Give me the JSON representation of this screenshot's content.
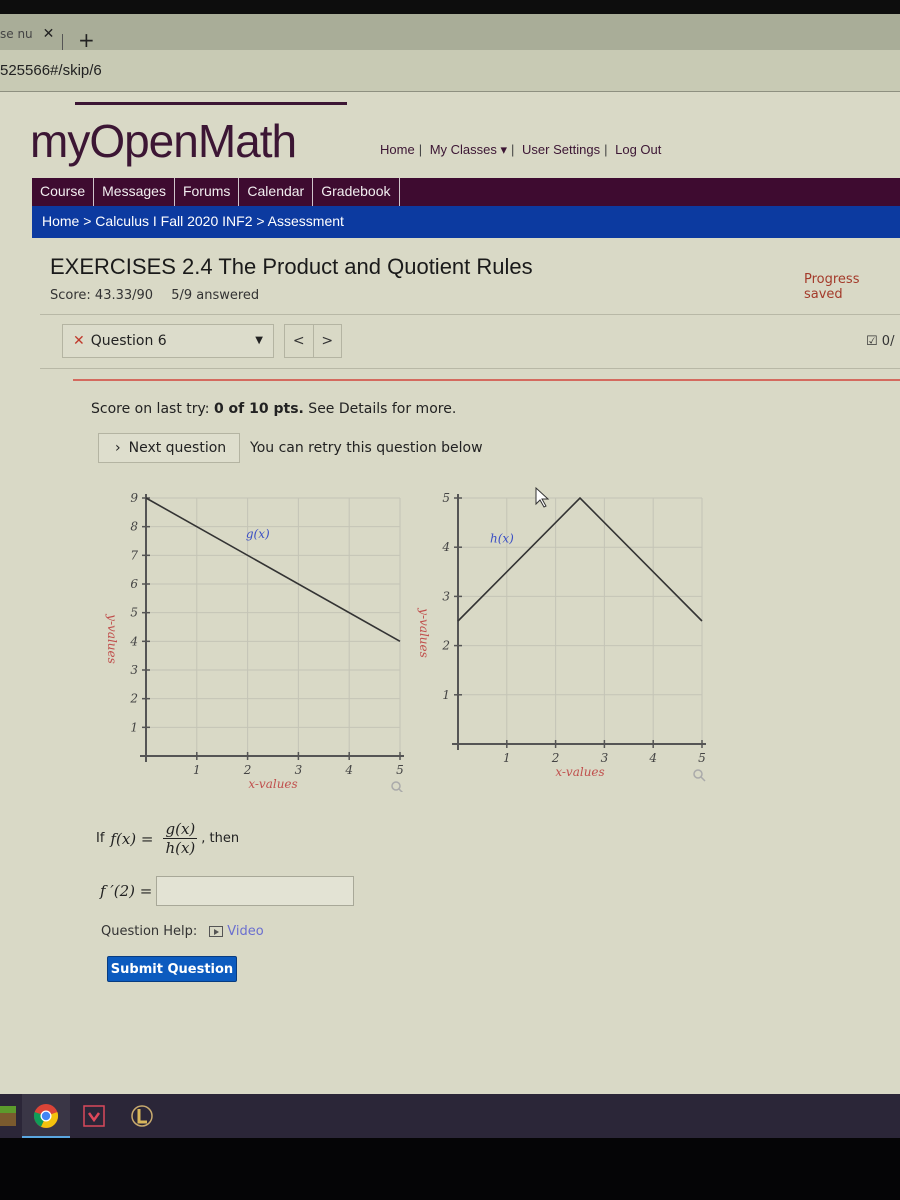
{
  "browser": {
    "tab_title": "se nu",
    "tab_close": "✕",
    "new_tab": "+",
    "url": "525566#/skip/6"
  },
  "header": {
    "logo": "myOpenMath",
    "topnav": [
      "Home",
      "My Classes ▾",
      "User Settings",
      "Log Out"
    ]
  },
  "menubar": {
    "items": [
      "Course",
      "Messages",
      "Forums",
      "Calendar",
      "Gradebook"
    ]
  },
  "breadcrumb": "Home > Calculus I Fall 2020 INF2 > Assessment",
  "assessment": {
    "title": "EXERCISES 2.4 The Product and Quotient Rules",
    "score": "Score: 43.33/90",
    "answered": "5/9 answered",
    "progress_saved": "Progress saved",
    "question_select": "Question 6",
    "question_status_icon": "✕",
    "prev": "<",
    "next": ">",
    "question_score": "0/"
  },
  "question": {
    "last_try_prefix": "Score on last try: ",
    "last_try_score": "0 of 10 pts.",
    "last_try_suffix": " See Details for more.",
    "next_question_label": "Next question",
    "retry_text": "You can retry this question below",
    "formula_if": "If",
    "formula_lhs": "f(x) =",
    "formula_num": "g(x)",
    "formula_den": "h(x)",
    "formula_then": ", then",
    "answer_label": "f ′(2) =",
    "answer_value": "",
    "help_label": "Question Help:",
    "video_label": "Video",
    "submit_label": "Submit Question"
  },
  "colors": {
    "brand_purple": "#3e0b30",
    "breadcrumb_blue": "#0c3aa0",
    "submit_blue": "#0c5bbf",
    "axis_label": "#c0504d",
    "curve_label": "#3b4fc4"
  },
  "chart_data": [
    {
      "type": "line",
      "name": "g(x)",
      "series": [
        {
          "name": "g(x)",
          "x": [
            0,
            5
          ],
          "y": [
            9,
            4
          ]
        }
      ],
      "xlabel": "x-values",
      "ylabel": "y-values",
      "xlim": [
        0,
        5
      ],
      "ylim": [
        0,
        9
      ],
      "xticks": [
        "1",
        "2",
        "3",
        "4",
        "5"
      ],
      "yticks": [
        "1",
        "2",
        "3",
        "4",
        "5",
        "6",
        "7",
        "8",
        "9"
      ],
      "grid": true,
      "annotation": "g(x)"
    },
    {
      "type": "line",
      "name": "h(x)",
      "series": [
        {
          "name": "h(x)",
          "x": [
            0,
            2.5,
            5
          ],
          "y": [
            2.5,
            5,
            2.5
          ]
        }
      ],
      "xlabel": "x-values",
      "ylabel": "y-values",
      "xlim": [
        0,
        5
      ],
      "ylim": [
        0,
        5
      ],
      "xticks": [
        "1",
        "2",
        "3",
        "4",
        "5"
      ],
      "yticks": [
        "1",
        "2",
        "3",
        "4",
        "5"
      ],
      "grid": true,
      "annotation": "h(x)"
    }
  ],
  "taskbar": {
    "apps": [
      "minecraft-icon",
      "chrome-icon",
      "valorant-icon",
      "league-of-legends-icon"
    ]
  }
}
